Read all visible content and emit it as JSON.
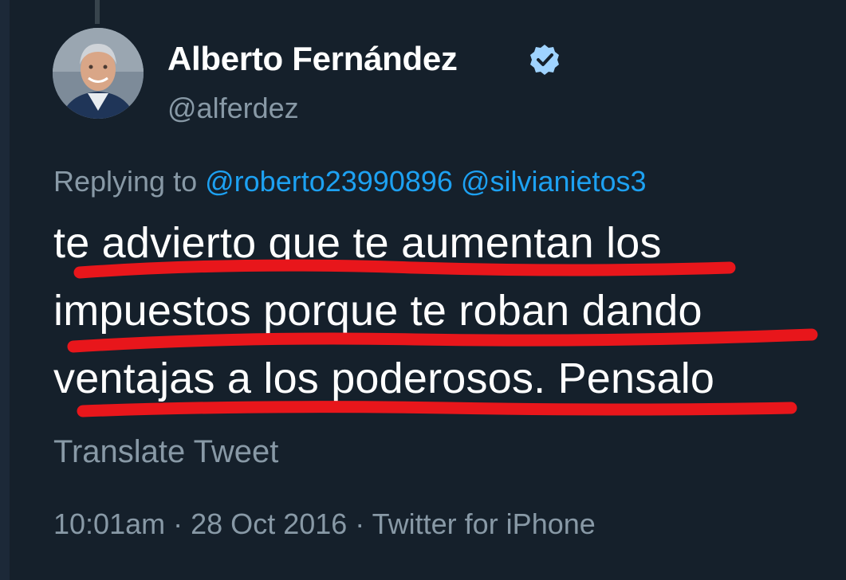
{
  "tweet": {
    "author": {
      "display_name": "Alberto Fernández",
      "handle": "@alferdez",
      "verified": true,
      "avatar_icon": "profile-photo"
    },
    "replying_prefix": "Replying to",
    "mentions": [
      "@roberto23990896",
      "@silvianietos3"
    ],
    "text_lines": [
      "te advierto que te aumentan los",
      "impuestos porque te roban dando",
      "ventajas a los poderosos. Pensalo"
    ],
    "translate_label": "Translate Tweet",
    "time": "10:01am",
    "separator": "·",
    "date": "28 Oct 2016",
    "source": "Twitter for iPhone"
  },
  "colors": {
    "background": "#15202b",
    "text": "#ffffff",
    "muted": "#8899a6",
    "link": "#1da1f2",
    "annotation": "#e8161b"
  }
}
